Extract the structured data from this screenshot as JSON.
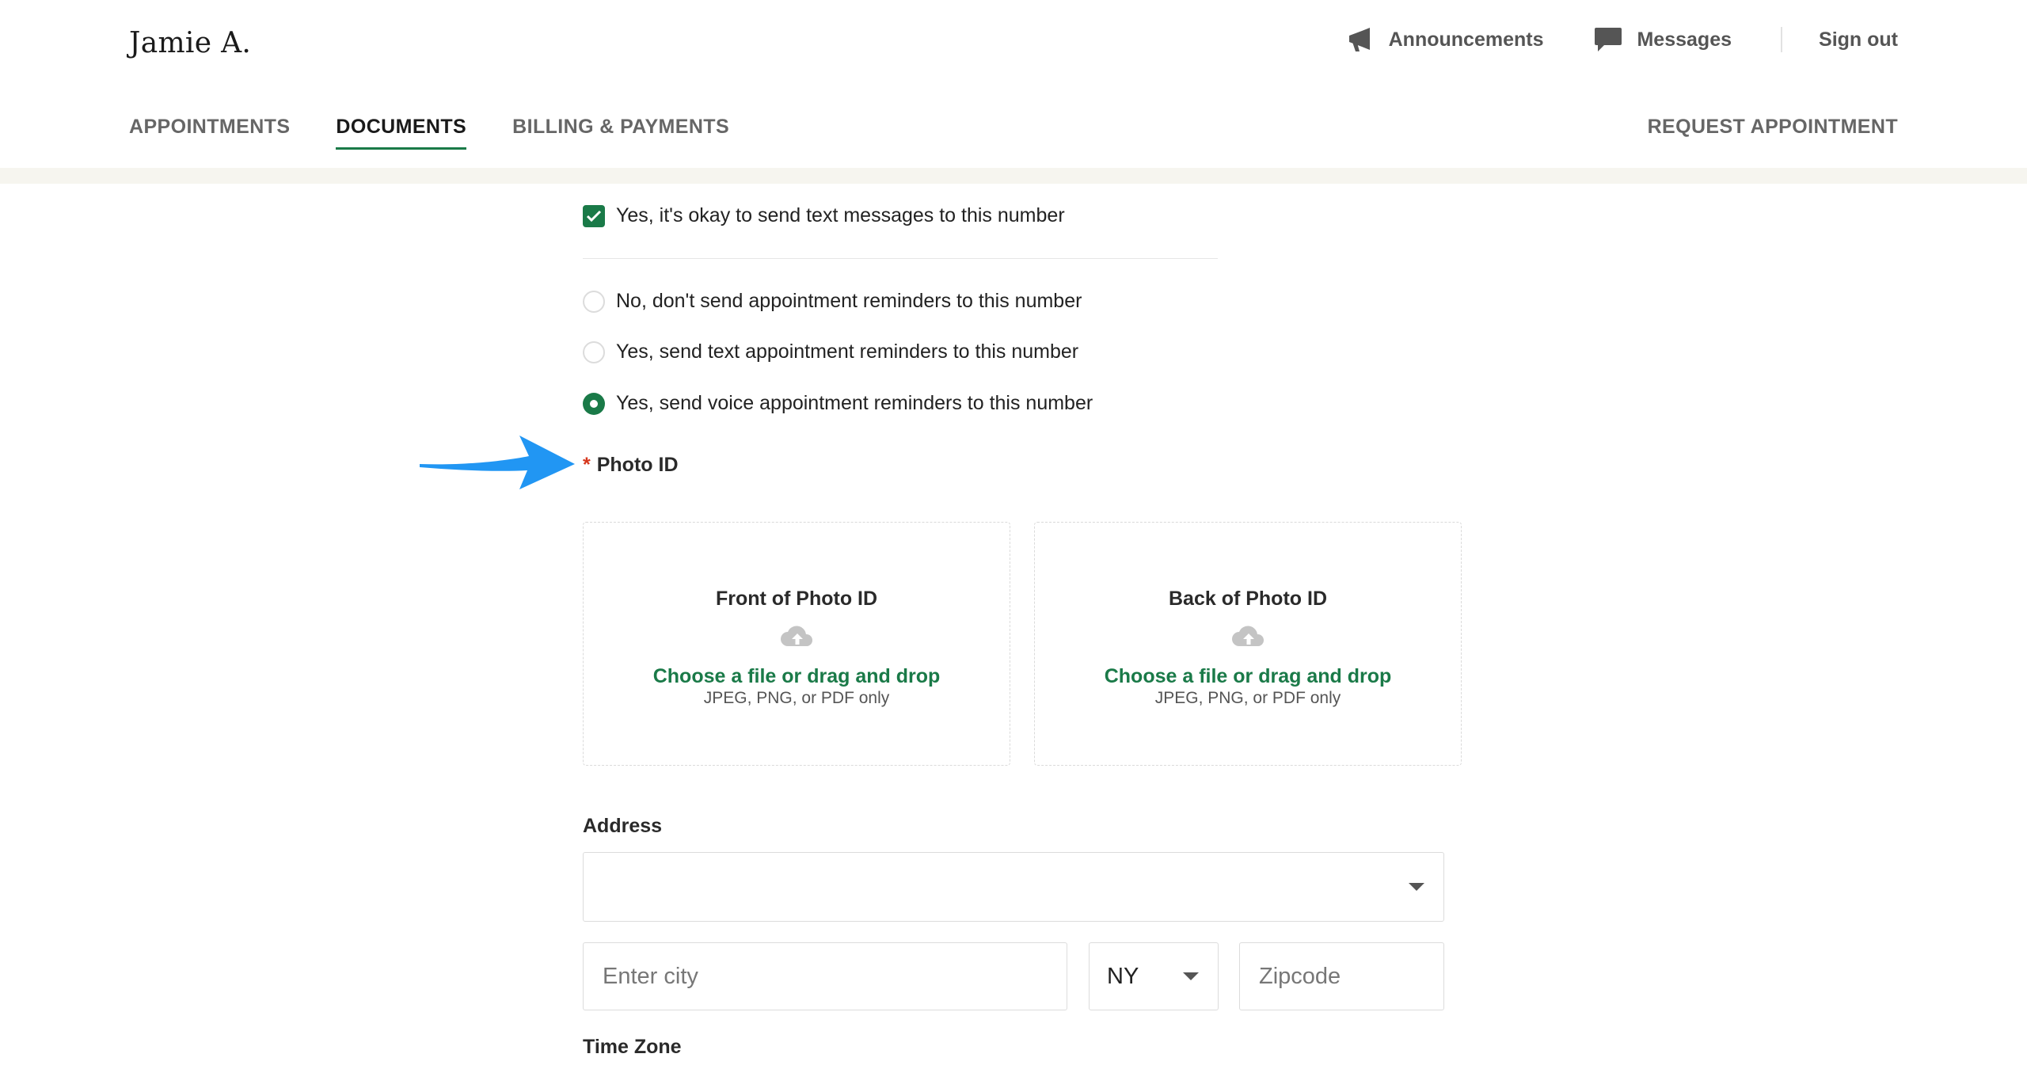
{
  "header": {
    "user_name": "Jamie A.",
    "announcements_label": "Announcements",
    "messages_label": "Messages",
    "sign_out_label": "Sign out"
  },
  "nav": {
    "tabs": [
      {
        "label": "APPOINTMENTS",
        "active": false
      },
      {
        "label": "DOCUMENTS",
        "active": true
      },
      {
        "label": "BILLING & PAYMENTS",
        "active": false
      }
    ],
    "request_label": "REQUEST APPOINTMENT"
  },
  "form": {
    "text_ok_label": "Yes, it's okay to send text messages to this number",
    "text_ok_checked": true,
    "reminder_options": [
      {
        "label": "No, don't send appointment reminders to this number",
        "selected": false
      },
      {
        "label": "Yes, send text appointment reminders to this number",
        "selected": false
      },
      {
        "label": "Yes, send voice appointment reminders to this number",
        "selected": true
      }
    ],
    "photo_id": {
      "required_mark": "*",
      "label": "Photo ID",
      "front": {
        "title": "Front of Photo ID",
        "choose": "Choose a file or drag and drop",
        "hint": "JPEG, PNG, or PDF only"
      },
      "back": {
        "title": "Back of Photo ID",
        "choose": "Choose a file or drag and drop",
        "hint": "JPEG, PNG, or PDF only"
      }
    },
    "address": {
      "label": "Address",
      "street_value": "",
      "city_placeholder": "Enter city",
      "state_value": "NY",
      "zip_placeholder": "Zipcode"
    },
    "time_zone_label": "Time Zone"
  },
  "colors": {
    "accent_green": "#1a7a48",
    "required_red": "#d6361c",
    "annotation_arrow": "#2196f3"
  }
}
